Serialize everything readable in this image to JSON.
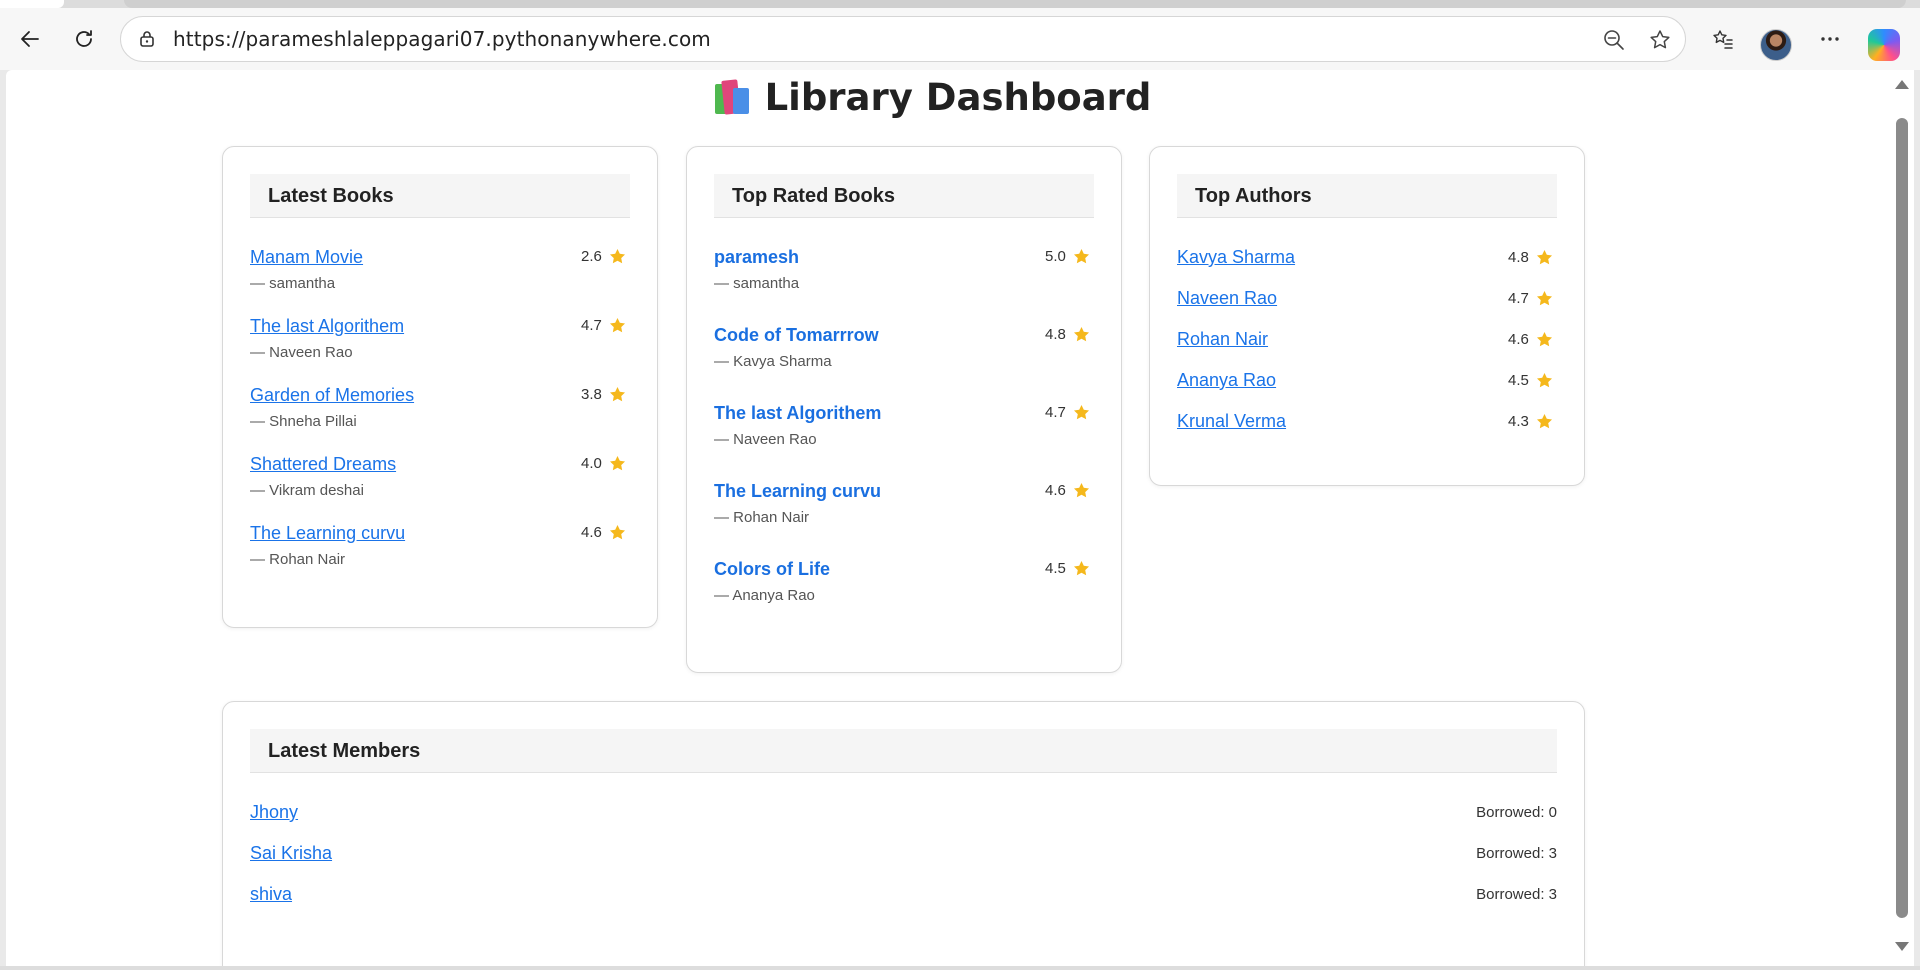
{
  "browser": {
    "url": "https://parameshlaleppagari07.pythonanywhere.com"
  },
  "page": {
    "title": "Library Dashboard",
    "title_icon": "books-emoji"
  },
  "latest_books": {
    "heading": "Latest Books",
    "items": [
      {
        "title": "Manam Movie",
        "author": "— samantha",
        "rating": "2.6"
      },
      {
        "title": "The last Algorithem",
        "author": "— Naveen Rao",
        "rating": "4.7"
      },
      {
        "title": "Garden of Memories",
        "author": "— Shneha Pillai",
        "rating": "3.8"
      },
      {
        "title": "Shattered Dreams",
        "author": "— Vikram deshai",
        "rating": "4.0"
      },
      {
        "title": "The Learning curvu",
        "author": "— Rohan Nair",
        "rating": "4.6"
      }
    ]
  },
  "top_rated_books": {
    "heading": "Top Rated Books",
    "items": [
      {
        "title": "paramesh",
        "author": "— samantha",
        "rating": "5.0"
      },
      {
        "title": "Code of Tomarrrow",
        "author": "— Kavya Sharma",
        "rating": "4.8"
      },
      {
        "title": "The last Algorithem",
        "author": "— Naveen Rao",
        "rating": "4.7"
      },
      {
        "title": "The Learning curvu",
        "author": "— Rohan Nair",
        "rating": "4.6"
      },
      {
        "title": "Colors of Life",
        "author": "— Ananya Rao",
        "rating": "4.5"
      }
    ]
  },
  "top_authors": {
    "heading": "Top Authors",
    "items": [
      {
        "name": "Kavya Sharma",
        "rating": "4.8"
      },
      {
        "name": "Naveen Rao",
        "rating": "4.7"
      },
      {
        "name": "Rohan Nair",
        "rating": "4.6"
      },
      {
        "name": "Ananya Rao",
        "rating": "4.5"
      },
      {
        "name": "Krunal Verma",
        "rating": "4.3"
      }
    ]
  },
  "latest_members": {
    "heading": "Latest Members",
    "items": [
      {
        "name": "Jhony",
        "borrowed": "Borrowed: 0"
      },
      {
        "name": "Sai Krisha",
        "borrowed": "Borrowed: 3"
      },
      {
        "name": "shiva",
        "borrowed": "Borrowed: 3"
      }
    ]
  },
  "colors": {
    "link": "#1a73e8",
    "star": "#f5b81c",
    "card_border": "#d8d8d8",
    "header_bg": "#f5f5f5"
  }
}
